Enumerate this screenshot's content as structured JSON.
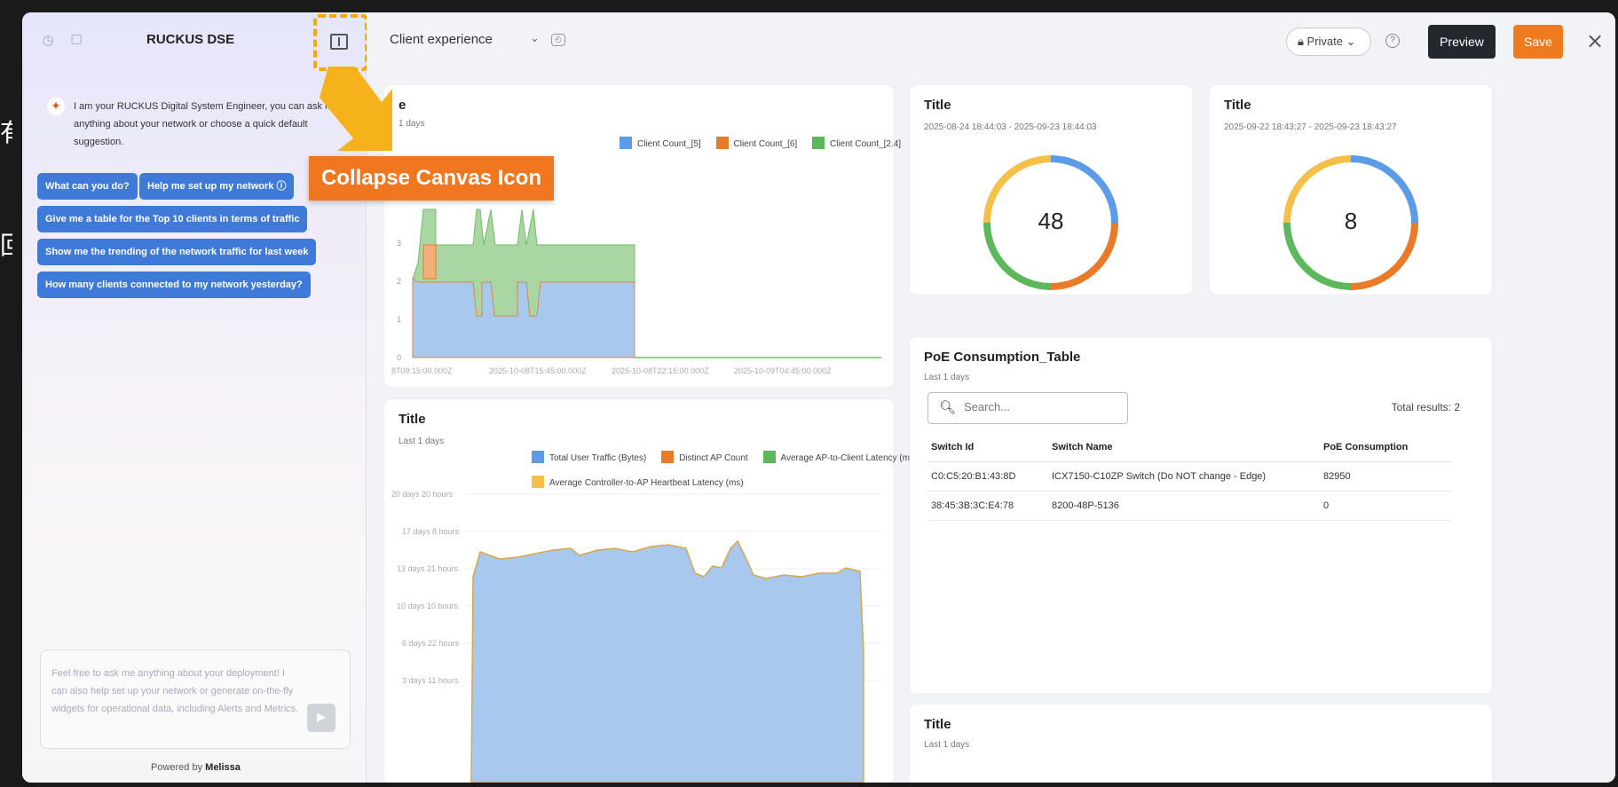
{
  "left_edge": {
    "glyph_top": "有",
    "glyph_bottom": "回"
  },
  "chat": {
    "title": "RUCKUS DSE",
    "header_icons": [
      "history-icon",
      "new-chat-icon"
    ],
    "intro": "I am your RUCKUS Digital System Engineer, you can ask me anything about your network or choose a quick default suggestion.",
    "suggestions": [
      "What can you do?",
      "Help me set up my network ⓘ",
      "Give me a table for the Top 10 clients in terms of traffic",
      "Show me the trending of the network traffic for last week",
      "How many clients connected to my network yesterday?"
    ],
    "input_placeholder": "Feel free to ask me anything about your deployment! I can also help set up your network or generate on-the-fly widgets for operational data, including Alerts and Metrics.",
    "powered_prefix": "Powered by",
    "powered_brand": "Melissa"
  },
  "annotation": {
    "label": "Collapse Canvas Icon",
    "color": "#f07620",
    "highlight_color": "#f5a800"
  },
  "topbar": {
    "dashboard_name": "Client experience",
    "visibility": "Private",
    "preview_label": "Preview",
    "save_label": "Save",
    "close_glyph": "×"
  },
  "widgets": {
    "client_count": {
      "title_partial": "e",
      "subtitle_partial": "1 days",
      "legend": [
        {
          "name": "Client Count_[5]",
          "color": "#5b9be8"
        },
        {
          "name": "Client Count_[6]",
          "color": "#ea7a28"
        },
        {
          "name": "Client Count_[2.4]",
          "color": "#5cb85c"
        }
      ],
      "y_ticks": [
        "0",
        "1",
        "2",
        "3"
      ],
      "x_ticks": [
        "8T09:15:00.000Z",
        "2025-10-08T15:45:00.000Z",
        "2025-10-08T22:15:00.000Z",
        "2025-10-09T04:45:00.000Z"
      ]
    },
    "traffic": {
      "title": "Title",
      "subtitle": "Last 1 days",
      "legend": [
        {
          "name": "Total User Traffic (Bytes)",
          "color": "#5b9be8"
        },
        {
          "name": "Distinct AP Count",
          "color": "#ea7a28"
        },
        {
          "name": "Average AP-to-Client Latency (ms)",
          "color": "#5cb85c"
        },
        {
          "name": "Average Controller-to-AP Heartbeat Latency (ms)",
          "color": "#f5c04a"
        }
      ],
      "y_ticks": [
        "20 days 20 hours",
        "17 days 8 hours",
        "13 days 21 hours",
        "10 days 10 hours",
        "6 days 22 hours",
        "3 days 11 hours"
      ]
    },
    "donut1": {
      "title": "Title",
      "range": "2025-08-24 18:44:03 - 2025-09-23 18:44:03",
      "value": "48",
      "segment_colors": [
        "#5b9be8",
        "#ea7a28",
        "#5cb85c",
        "#f5c04a"
      ]
    },
    "donut2": {
      "title": "Title",
      "range": "2025-09-22 18:43:27 - 2025-09-23 18:43:27",
      "value": "8",
      "segment_colors": [
        "#5b9be8",
        "#ea7a28",
        "#5cb85c",
        "#f5c04a"
      ]
    },
    "poe": {
      "title": "PoE Consumption_Table",
      "subtitle": "Last 1 days",
      "search_placeholder": "Search...",
      "total": "Total results: 2",
      "columns": [
        "Switch Id",
        "Switch Name",
        "PoE Consumption"
      ],
      "rows": [
        [
          "C0:C5:20:B1:43:8D",
          "ICX7150-C10ZP Switch (Do NOT change - Edge)",
          "82950"
        ],
        [
          "38:45:3B:3C:E4:78",
          "8200-48P-5136",
          "0"
        ]
      ]
    },
    "bottom": {
      "title": "Title",
      "subtitle": "Last 1 days"
    }
  }
}
